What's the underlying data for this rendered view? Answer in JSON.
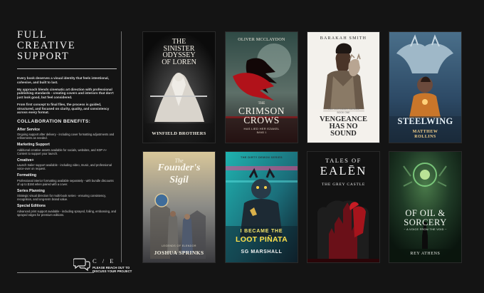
{
  "panel": {
    "title_line1": "FULL",
    "title_line2": "CREATIVE",
    "title_line3": "SUPPORT",
    "intro": [
      "Every book deserves a visual identity that feels intentional, cohesive, and built to last.",
      "My approach blends cinematic art direction with professional publishing standards - creating covers and interiors that don't just look good, but feel considered.",
      "From first concept to final files, the process is guided, structured, and focused on clarity, quality, and consistency across every format."
    ],
    "collab_heading": "COLLABORATION BENEFITS:",
    "benefits": [
      {
        "title": "After Service",
        "text": "Ongoing support after delivery - including cover formatting adjustments and refinements as needed."
      },
      {
        "title": "Marketing Support",
        "text": "Additional creative assets available for socials, websites, and KDP A+ Content to support your launch."
      },
      {
        "title": "Creative+",
        "text": "Launch trailer support available - including video, music, and professional voice-over on request."
      },
      {
        "title": "Formatting",
        "text": "Professional interior formatting available separately - with bundle discounts of up to $150 when paired with a cover."
      },
      {
        "title": "Series Planning",
        "text": "Strategic visual direction for multi-book series - ensuring consistency, recognition, and long-term brand value."
      },
      {
        "title": "Special Editions",
        "text": "Advanced print support available - including sprayed, foiling, embossing, and sprayed edges for premium editions."
      }
    ]
  },
  "cta": {
    "logo": "C / E",
    "line1": "PLEASE REACH OUT TO",
    "line2": "DISCUSS YOUR PROJECT",
    "icon": "chat-bubbles-icon"
  },
  "covers": [
    {
      "id": "sinister",
      "title_lines": [
        "THE",
        "SINISTER",
        "ODYSSEY",
        "OF LOREN"
      ],
      "author": "WINFIELD BROTHERS"
    },
    {
      "id": "crimson",
      "author": "OLIVER MCCLAYDON",
      "title_small": "THE",
      "title_lines": [
        "CRIMSON",
        "CROWS"
      ],
      "subtitle": "HAS LIED HER EZAKEL",
      "book": "BAND 1"
    },
    {
      "id": "vengeance",
      "author": "BARAKAH SMITH",
      "tagline": "THE OUTSIDER SERIES",
      "book": "BOOK ONE",
      "title_lines": [
        "VENGEANCE",
        "HAS NO",
        "SOUND"
      ]
    },
    {
      "id": "steelwing",
      "title_lines": [
        "STEELWING"
      ],
      "author_lines": [
        "MATTHEW",
        "ROLLINS"
      ]
    },
    {
      "id": "founders",
      "title_small": "The",
      "title_lines": [
        "Founder's",
        "Sigil"
      ],
      "series": "LEGENDS OF ELENDOR",
      "author": "JOSHUA SPRINKS"
    },
    {
      "id": "pinata",
      "tagline": "THE DIRTY DEMON SERIES",
      "title_small": "I BECAME THE",
      "title_lines": [
        "LOOT PIÑATA"
      ],
      "author": "SG MARSHALL"
    },
    {
      "id": "ealen",
      "title_small": "TALES OF",
      "title_lines": [
        "EALĒN"
      ],
      "subtitle": "THE GREY CASTLE"
    },
    {
      "id": "oil",
      "title_lines": [
        "OF OIL &",
        "SORCERY"
      ],
      "subtitle": "~ A VOICE FROM THE VOID ~",
      "author": "REY ATHENS"
    }
  ]
}
